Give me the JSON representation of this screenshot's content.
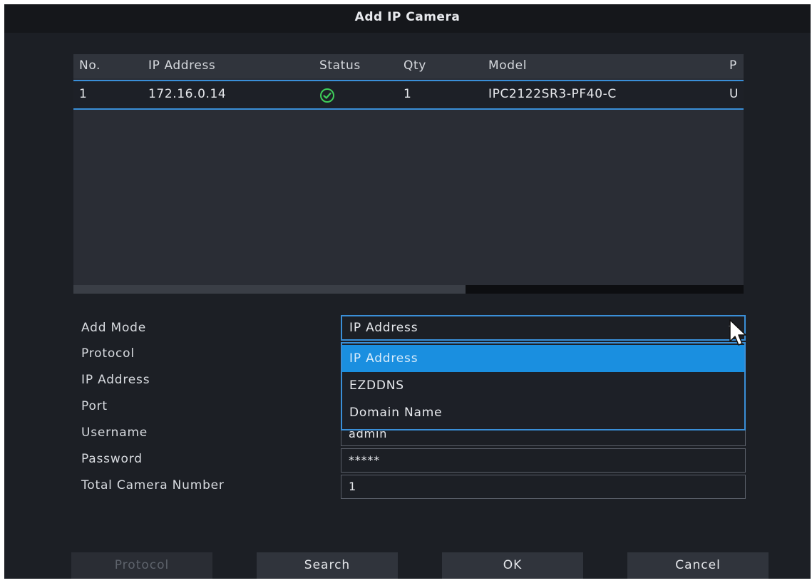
{
  "dialog": {
    "title": "Add IP Camera"
  },
  "table": {
    "headers": [
      "No.",
      "IP Address",
      "Status",
      "Qty",
      "Model",
      "P"
    ],
    "rows": [
      {
        "no": "1",
        "ip": "172.16.0.14",
        "status_icon": "check-circle-icon",
        "qty": "1",
        "model": "IPC2122SR3-PF40-C",
        "p": "U"
      }
    ]
  },
  "form": {
    "labels": {
      "add_mode": "Add Mode",
      "protocol": "Protocol",
      "ip_address": "IP Address",
      "port": "Port",
      "username": "Username",
      "password": "Password",
      "total_camera_number": "Total Camera Number"
    },
    "add_mode_value": "IP Address",
    "add_mode_options": [
      "IP Address",
      "EZDDNS",
      "Domain Name"
    ],
    "add_mode_selected_index": 0,
    "username": "admin",
    "password": "*****",
    "total_camera_number": "1"
  },
  "buttons": {
    "protocol": "Protocol",
    "search": "Search",
    "ok": "OK",
    "cancel": "Cancel"
  },
  "colors": {
    "accent": "#3a8fd8",
    "selected_option": "#1a8fe0",
    "status_ok": "#3fcf5a"
  }
}
